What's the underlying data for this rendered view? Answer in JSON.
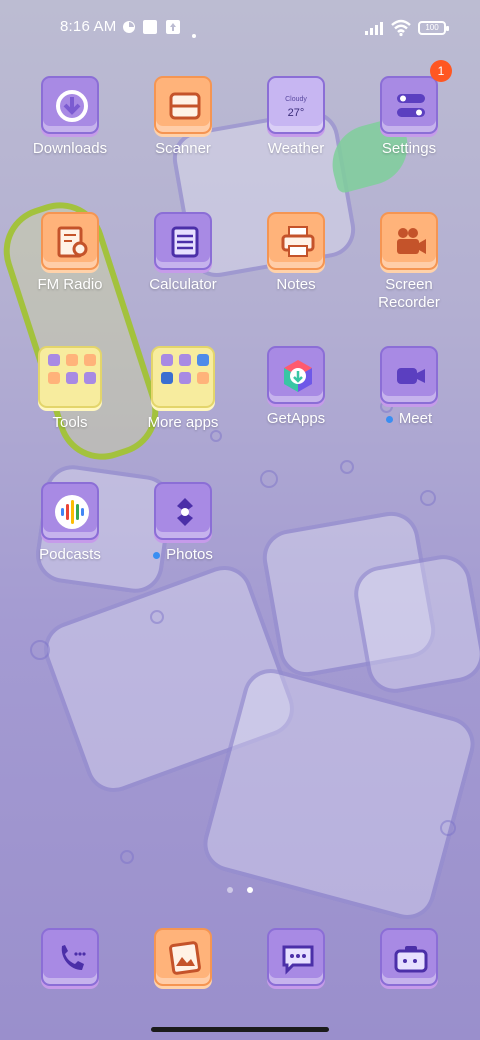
{
  "status_bar": {
    "time": "8:16 AM",
    "battery": "100"
  },
  "apps": [
    {
      "label": "Downloads",
      "icon": "download-icon",
      "color": "purple"
    },
    {
      "label": "Scanner",
      "icon": "scanner-icon",
      "color": "orange"
    },
    {
      "label": "Weather",
      "icon": "weather-icon",
      "color": "purple",
      "widget_text": "Cloudy",
      "widget_temp": "27°"
    },
    {
      "label": "Settings",
      "icon": "settings-icon",
      "color": "purple",
      "badge": "1"
    },
    {
      "label": "FM Radio",
      "icon": "radio-icon",
      "color": "orange"
    },
    {
      "label": "Calculator",
      "icon": "calculator-icon",
      "color": "purple"
    },
    {
      "label": "Notes",
      "icon": "printer-icon",
      "color": "orange"
    },
    {
      "label": "Screen\nRecorder",
      "icon": "video-recorder-icon",
      "color": "orange"
    },
    {
      "label": "Tools",
      "icon": "folder-icon",
      "color": "folder"
    },
    {
      "label": "More apps",
      "icon": "folder-icon",
      "color": "folder"
    },
    {
      "label": "GetApps",
      "icon": "getapps-icon",
      "color": "purple"
    },
    {
      "label": "Meet",
      "icon": "video-camera-icon",
      "color": "purple"
    },
    {
      "label": "Podcasts",
      "icon": "podcast-icon",
      "color": "purple"
    },
    {
      "label": "Photos",
      "icon": "photos-icon",
      "color": "purple"
    }
  ],
  "dock": [
    {
      "name": "phone",
      "icon": "phone-icon"
    },
    {
      "name": "gallery",
      "icon": "gallery-icon"
    },
    {
      "name": "messages",
      "icon": "message-icon"
    },
    {
      "name": "camera",
      "icon": "camera-icon"
    }
  ],
  "pager": {
    "pages": 2,
    "active": 2
  },
  "colors": {
    "accent_badge": "#ff5722",
    "dot": "#3a8ef2"
  }
}
